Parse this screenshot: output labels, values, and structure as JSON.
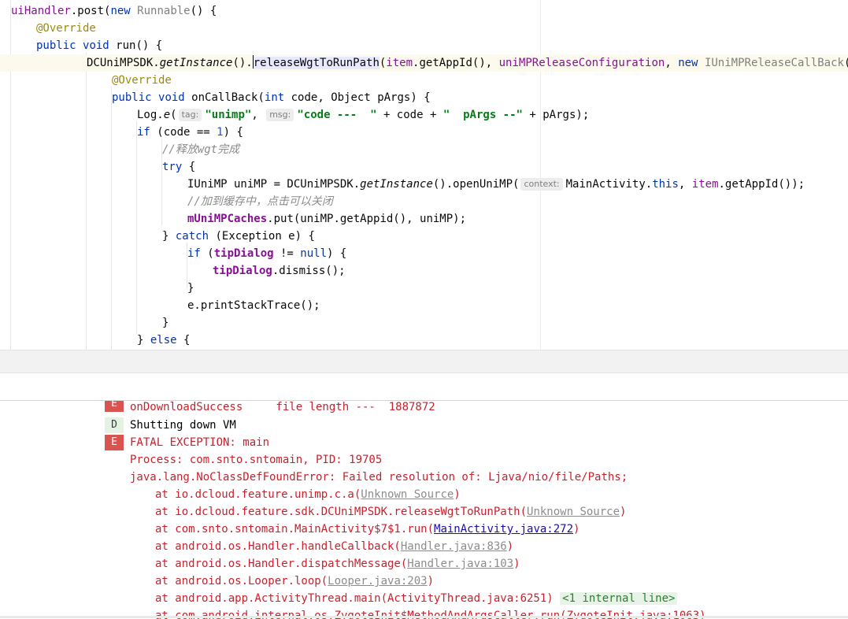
{
  "editor": {
    "tokens": {
      "uiHandler": "uiHandler",
      "post_open": ".post(",
      "new": "new",
      "Runnable": "Runnable",
      "paren_brace": "() {",
      "override": "@Override",
      "public": "public",
      "void": "void",
      "run_sig": "run() {",
      "DCUniMPSDK_dot": "DCUniMPSDK.",
      "getInstance": "getInstance",
      "call_dot": "().",
      "caret_char": "r",
      "releaseWgt_rest": "eleaseWgtToRunPath",
      "open_paren": "(",
      "item": "item",
      "getAppId_call": ".getAppId(), ",
      "uniMPReleaseConfiguration": "uniMPReleaseConfiguration",
      "comma_space": ", ",
      "IUniMPReleaseCallBack": "IUniMPReleaseCallBack",
      "sig_tail": "() {",
      "onCallBack_open": "onCallBack(",
      "int": "int",
      "code_param": " code, Object pArgs) {",
      "log_e_prefix": "Log.",
      "log_e_method": "e",
      "tag_hint": "tag:",
      "unimp_str": "\"unimp\"",
      "msg_hint": "msg:",
      "code_str": "\"code ---  \"",
      "plus_code": " + code + ",
      "pargs_str": "\"  pArgs --\"",
      "plus_pargs": " + pArgs);",
      "if": "if",
      "if_cond_open": " (code == ",
      "one": "1",
      "if_cond_close": ") {",
      "comment_release": "//释放wgt完成",
      "try": "try",
      "brace_open": " {",
      "unimp_decl": "IUniMP uniMP = DCUniMPSDK.",
      "openUniMP": "().openUniMP(",
      "context_hint": "context:",
      "MainActivity_dot": "MainActivity.",
      "this": "this",
      "getAppId_end": ".getAppId());",
      "comment_cache": "//加到缓存中，点击可以关闭",
      "mUniMPCaches": "mUniMPCaches",
      "put_call": ".put(uniMP.getAppid(), uniMP);",
      "close_brace": "}",
      "catch": "catch",
      "catch_args": " (Exception e) {",
      "tipDialog": "tipDialog",
      "neq": " != ",
      "null": "null",
      "dismiss": ".dismiss();",
      "print_stack": "e.printStackTrace();",
      "else": "else"
    }
  },
  "console": {
    "partial_line": "onDownloadSuccess     file length ---  1887872",
    "badge_e": "E",
    "badge_d": "D",
    "shutting_down": "Shutting down VM",
    "fatal": "FATAL EXCEPTION: main",
    "process": "Process: com.snto.sntomain, PID: 19705",
    "error": "java.lang.NoClassDefFoundError: Failed resolution of: Ljava/nio/file/Paths;",
    "frames": [
      {
        "prefix": "at io.dcloud.feature.unimp.c.a(",
        "link": "Unknown Source",
        "suffix": ")"
      },
      {
        "prefix": "at io.dcloud.feature.sdk.DCUniMPSDK.releaseWgtToRunPath(",
        "link": "Unknown Source",
        "suffix": ")"
      },
      {
        "prefix": "at com.snto.sntomain.MainActivity$7$1.run(",
        "link": "MainActivity.java:272",
        "suffix": ")"
      },
      {
        "prefix": "at android.os.Handler.handleCallback(",
        "link": "Handler.java:836",
        "suffix": ")"
      },
      {
        "prefix": "at android.os.Handler.dispatchMessage(",
        "link": "Handler.java:103",
        "suffix": ")"
      },
      {
        "prefix": "at android.os.Looper.loop(",
        "link": "Looper.java:203",
        "suffix": ")"
      },
      {
        "prefix": "at android.app.ActivityThread.main(ActivityThread.java:6251) ",
        "link": "<1 internal line>",
        "suffix": ""
      },
      {
        "prefix": "at com.android.internal.os.ZygoteInit$MethodAndArgsCaller.run(ZygoteInit.java:1063)",
        "link": "",
        "suffix": ""
      }
    ]
  },
  "colors": {
    "keyword": "#0033b3",
    "annotation": "#9e880d",
    "string": "#067d17",
    "field": "#871094",
    "error_text": "#c7222d",
    "error_badge": "#d9534f"
  }
}
